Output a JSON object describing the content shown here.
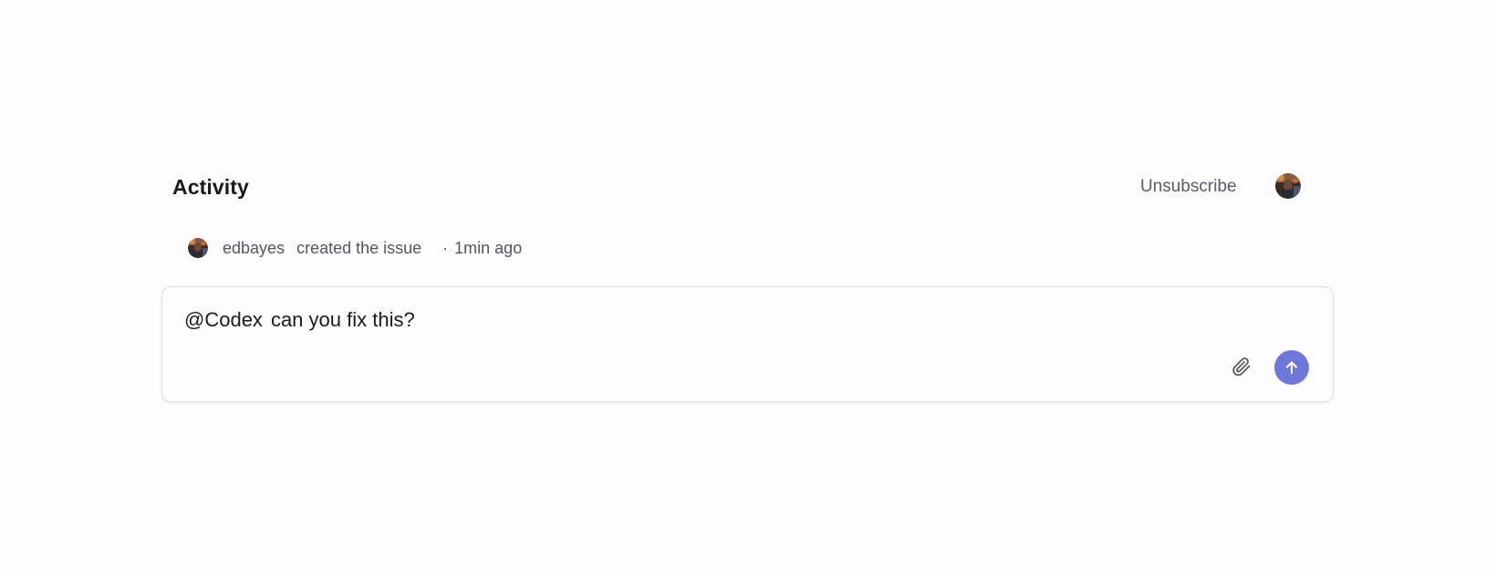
{
  "activity": {
    "title": "Activity",
    "unsubscribe_label": "Unsubscribe"
  },
  "event": {
    "user": "edbayes",
    "action": "created the issue",
    "separator": "·",
    "time": "1min ago"
  },
  "comment": {
    "mention": "@Codex",
    "text": "can you fix this?"
  },
  "icons": {
    "attach": "paperclip-icon",
    "send": "arrow-up-icon"
  },
  "colors": {
    "send_button": "#6f78d9",
    "background": "#fdfdfd"
  }
}
